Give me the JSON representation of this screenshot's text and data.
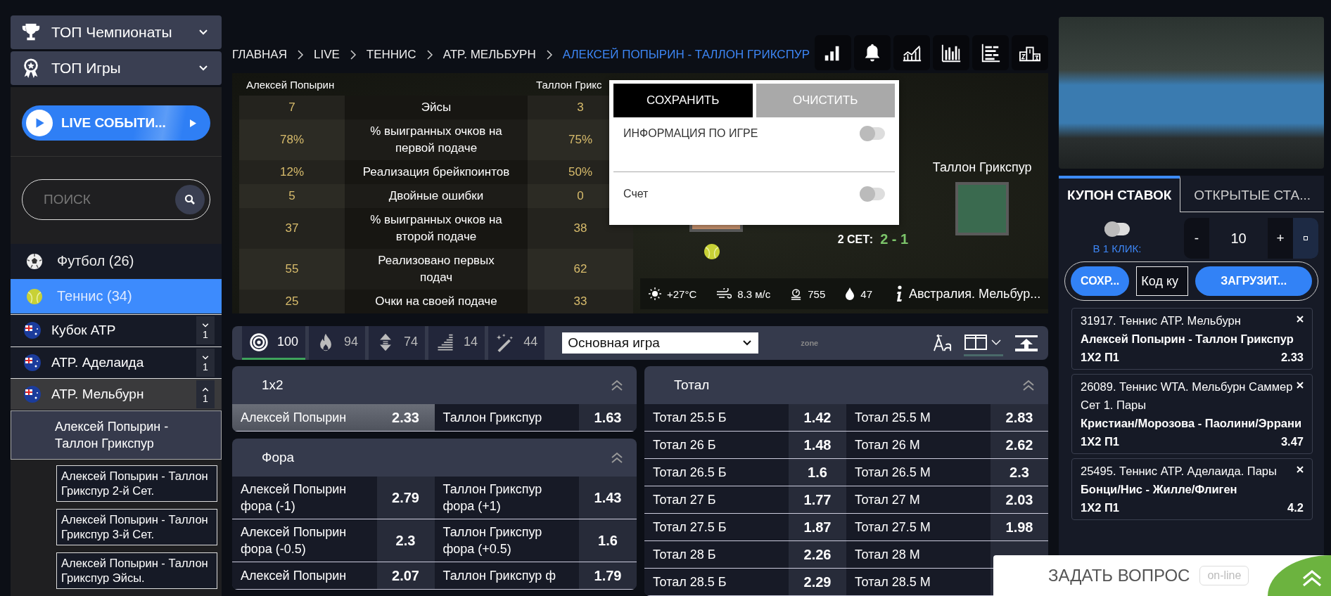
{
  "sidebar": {
    "sections": [
      {
        "title": "ТОП Чемпионаты",
        "kind": "trophy",
        "expanded": false
      },
      {
        "title": "ТОП Игры",
        "kind": "award",
        "expanded": false
      }
    ],
    "live_button": {
      "label": "LIVE СОБЫТИ..."
    },
    "search": {
      "placeholder": "ПОИСК"
    },
    "sports": [
      {
        "name": "Футбол (26)",
        "kind": "football",
        "selected": false
      },
      {
        "name": "Теннис (34)",
        "kind": "tennis",
        "selected": true
      }
    ],
    "leagues": [
      {
        "name": "Кубок ATP",
        "count": "1",
        "expanded": false,
        "selected": false
      },
      {
        "name": "ATP. Аделаида",
        "count": "1",
        "expanded": false,
        "selected": false
      },
      {
        "name": "ATP. Мельбурн",
        "count": "1",
        "expanded": true,
        "selected": true,
        "children": [
          {
            "name": "Алексей Попырин - Таллон Грикспур",
            "selected": true,
            "children": [
              {
                "name": "Алексей Попырин - Таллон Грикспур 2-й Сет."
              },
              {
                "name": "Алексей Попырин - Таллон Грикспур 3-й Сет."
              },
              {
                "name": "Алексей Попырин - Таллон Грикспур Эйсы."
              }
            ]
          }
        ]
      }
    ]
  },
  "breadcrumbs": [
    {
      "label": "ГЛАВНАЯ",
      "current": false
    },
    {
      "label": "LIVE",
      "current": false
    },
    {
      "label": "ТЕННИС",
      "current": false
    },
    {
      "label": "ATP. МЕЛЬБУРН",
      "current": false
    },
    {
      "label": "АЛЕКСЕЙ ПОПЫРИН - ТАЛЛОН ГРИКСПУР",
      "current": true
    }
  ],
  "toolbar": [
    {
      "kind": "signal"
    },
    {
      "kind": "bell"
    },
    {
      "kind": "line-chart"
    },
    {
      "kind": "bar-chart"
    },
    {
      "kind": "list"
    },
    {
      "kind": "podium"
    }
  ],
  "stats": {
    "home": "Алексей Попырин",
    "away": "Таллон Грикс",
    "rows": [
      {
        "home": "7",
        "label": "Эйсы",
        "away": "3"
      },
      {
        "home": "78%",
        "label": "% выигранных очков на первой подаче",
        "away": "75%"
      },
      {
        "home": "12%",
        "label": "Реализация брейкпоинтов",
        "away": "50%"
      },
      {
        "home": "5",
        "label": "Двойные ошибки",
        "away": "0"
      },
      {
        "home": "37",
        "label": "% выигранных очков на второй подаче",
        "away": "38"
      },
      {
        "home": "55",
        "label": "Реализовано первых подач",
        "away": "62"
      },
      {
        "home": "25",
        "label": "Очки на своей подаче",
        "away": "33"
      }
    ]
  },
  "match": {
    "away_player": "Таллон Грикспур",
    "set_label": "2 СЕТ:",
    "set_score": "2 - 1"
  },
  "weather": {
    "temperature": "+27°C",
    "wind": "8.3 м/с",
    "pressure": "755",
    "humidity": "47",
    "location": "Австралия. Мельбур..."
  },
  "popup": {
    "buttons": [
      {
        "label": "СОХРАНИТЬ",
        "kind": "primary"
      },
      {
        "label": "ОЧИСТИТЬ",
        "kind": "secondary"
      }
    ],
    "options": [
      {
        "label": "ИНФОРМАЦИЯ ПО ИГРЕ",
        "on": false
      },
      {
        "label": "Счет",
        "on": false
      }
    ]
  },
  "filter_bar": {
    "tabs": [
      {
        "kind": "all",
        "count": "100",
        "selected": true
      },
      {
        "kind": "hot",
        "count": "94",
        "selected": false
      },
      {
        "kind": "updown",
        "count": "74",
        "selected": false
      },
      {
        "kind": "stack",
        "count": "14",
        "selected": false
      },
      {
        "kind": "magic",
        "count": "44",
        "selected": false
      }
    ],
    "market_select": {
      "value": "Основная игра"
    },
    "zone_label": "zone"
  },
  "markets": {
    "left": [
      {
        "title": "1x2",
        "rows": [
          {
            "outcomes": [
              {
                "label": "Алексей Попырин",
                "odds": "2.33",
                "selected": true
              },
              {
                "label": "Таллон Грикспур",
                "odds": "1.63",
                "selected": false
              }
            ]
          }
        ]
      },
      {
        "title": "Фора",
        "rows": [
          {
            "outcomes": [
              {
                "label": "Алексей Попырин фора (-1)",
                "odds": "2.79",
                "selected": false
              },
              {
                "label": "Таллон Грикспур фора (+1)",
                "odds": "1.43",
                "selected": false
              }
            ]
          },
          {
            "outcomes": [
              {
                "label": "Алексей Попырин фора (-0.5)",
                "odds": "2.3",
                "selected": false
              },
              {
                "label": "Таллон Грикспур фора (+0.5)",
                "odds": "1.6",
                "selected": false
              }
            ]
          },
          {
            "outcomes": [
              {
                "label": "Алексей Попырин",
                "odds": "2.07",
                "selected": false
              },
              {
                "label": "Таллон Грикспур ф",
                "odds": "1.79",
                "selected": false
              }
            ]
          }
        ]
      }
    ],
    "right": [
      {
        "title": "Тотал",
        "rows": [
          {
            "outcomes": [
              {
                "label": "Тотал 25.5 Б",
                "odds": "1.42",
                "selected": false
              },
              {
                "label": "Тотал 25.5 М",
                "odds": "2.83",
                "selected": false
              }
            ]
          },
          {
            "outcomes": [
              {
                "label": "Тотал 26 Б",
                "odds": "1.48",
                "selected": false
              },
              {
                "label": "Тотал 26 М",
                "odds": "2.62",
                "selected": false
              }
            ]
          },
          {
            "outcomes": [
              {
                "label": "Тотал 26.5 Б",
                "odds": "1.6",
                "selected": false
              },
              {
                "label": "Тотал 26.5 М",
                "odds": "2.3",
                "selected": false
              }
            ]
          },
          {
            "outcomes": [
              {
                "label": "Тотал 27 Б",
                "odds": "1.77",
                "selected": false
              },
              {
                "label": "Тотал 27 М",
                "odds": "2.03",
                "selected": false
              }
            ]
          },
          {
            "outcomes": [
              {
                "label": "Тотал 27.5 Б",
                "odds": "1.87",
                "selected": false
              },
              {
                "label": "Тотал 27.5 М",
                "odds": "1.98",
                "selected": false
              }
            ]
          },
          {
            "outcomes": [
              {
                "label": "Тотал 28 Б",
                "odds": "2.26",
                "selected": false
              },
              {
                "label": "Тотал 28 М",
                "selected": false
              }
            ]
          },
          {
            "outcomes": [
              {
                "label": "Тотал 28.5 Б",
                "odds": "2.29",
                "selected": false
              },
              {
                "label": "Тотал 28.5 М",
                "selected": false
              }
            ]
          }
        ]
      }
    ]
  },
  "coupon": {
    "tabs": [
      {
        "label": "КУПОН СТАВОК",
        "selected": true
      },
      {
        "label": "ОТКРЫТЫЕ СТА...",
        "selected": false
      }
    ],
    "one_click": {
      "label": "В 1 КЛИК:",
      "on": false
    },
    "stake": {
      "minus": "-",
      "value": "10",
      "plus": "+"
    },
    "save_button": "СОХР...",
    "code_field": {
      "placeholder": "Код ку"
    },
    "load_button": "ЗАГРУЗИТ...",
    "bets": [
      {
        "event": "31917. Теннис ATP. Мельбурн",
        "match": "Алексей Попырин - Таллон Грикспур",
        "market": "1X2 П1",
        "odds": "2.33"
      },
      {
        "event": "26089. Теннис WTA. Мельбурн Саммер Сет 1. Пары",
        "match": "Кристиан/Морозова - Паолини/Эррани",
        "market": "1X2 П1",
        "odds": "3.47"
      },
      {
        "event": "25495. Теннис ATP. Аделаида. Пары",
        "match": "Бонци/Нис - Жилле/Флиген",
        "market": "1X2 П1",
        "odds": "4.2"
      }
    ]
  },
  "chat": {
    "label": "ЗАДАТЬ ВОПРОС",
    "status": "on-line"
  }
}
